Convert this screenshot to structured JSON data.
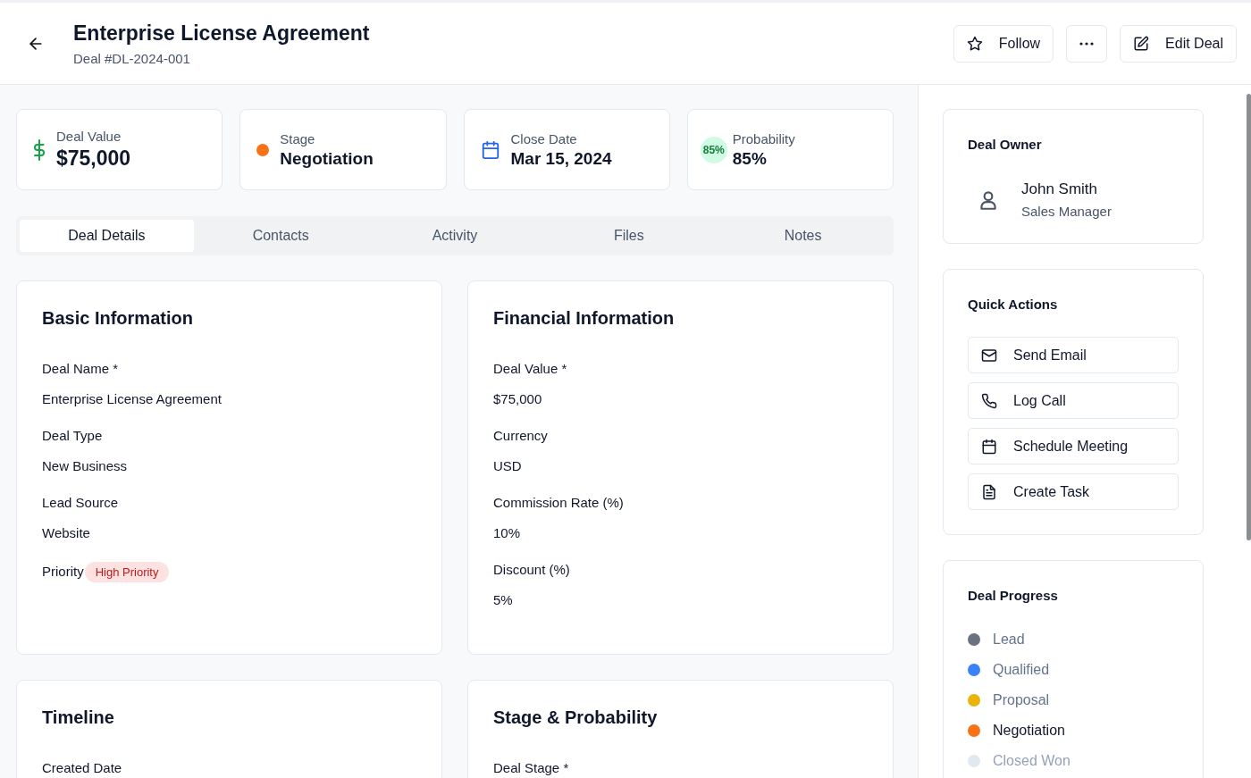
{
  "header": {
    "title": "Enterprise License Agreement",
    "subtitle": "Deal #DL-2024-001"
  },
  "actions": [
    {
      "kind": "follow",
      "label": "Follow"
    },
    {
      "kind": "more"
    },
    {
      "kind": "edit",
      "label": "Edit Deal"
    }
  ],
  "stats": [
    {
      "kind": "money",
      "label": "Deal Value",
      "value": "$75,000"
    },
    {
      "kind": "dot",
      "label": "Stage",
      "value": "Negotiation",
      "color": "#f97316"
    },
    {
      "kind": "calendar",
      "label": "Close Date",
      "value": "Mar 15, 2024"
    },
    {
      "kind": "percent",
      "badge": "85%",
      "label": "Probability",
      "value": "85%"
    }
  ],
  "tabs": [
    {
      "label": "Deal Details",
      "selected": true
    },
    {
      "label": "Contacts",
      "selected": false
    },
    {
      "label": "Activity",
      "selected": false
    },
    {
      "label": "Files",
      "selected": false
    },
    {
      "label": "Notes",
      "selected": false
    }
  ],
  "sections": [
    {
      "title": "Basic Information",
      "fields": [
        {
          "label": "Deal Name *",
          "value": "Enterprise License Agreement"
        },
        {
          "label": "Deal Type",
          "value": "New Business"
        },
        {
          "label": "Lead Source",
          "value": "Website"
        },
        {
          "label": "Priority",
          "badge": "High Priority"
        }
      ]
    },
    {
      "title": "Financial Information",
      "fields": [
        {
          "label": "Deal Value *",
          "value": "$75,000"
        },
        {
          "label": "Currency",
          "value": "USD"
        },
        {
          "label": "Commission Rate (%)",
          "value": "10%"
        },
        {
          "label": "Discount (%)",
          "value": "5%"
        }
      ]
    },
    {
      "title": "Timeline",
      "fields": [
        {
          "label": "Created Date"
        }
      ]
    },
    {
      "title": "Stage & Probability",
      "fields": [
        {
          "label": "Deal Stage *"
        }
      ]
    }
  ],
  "owner": {
    "heading": "Deal Owner",
    "name": "John Smith",
    "role": "Sales Manager"
  },
  "quick_actions": {
    "heading": "Quick Actions",
    "items": [
      {
        "kind": "mail",
        "label": "Send Email"
      },
      {
        "kind": "phone",
        "label": "Log Call"
      },
      {
        "kind": "calendar",
        "label": "Schedule Meeting"
      },
      {
        "kind": "document",
        "label": "Create Task"
      }
    ]
  },
  "progress": {
    "heading": "Deal Progress",
    "stages": [
      {
        "label": "Lead",
        "color": "#6b7280",
        "kind": "done"
      },
      {
        "label": "Qualified",
        "color": "#3b82f6",
        "kind": "done"
      },
      {
        "label": "Proposal",
        "color": "#eab308",
        "kind": "done"
      },
      {
        "label": "Negotiation",
        "color": "#f97316",
        "kind": "current"
      },
      {
        "label": "Closed Won",
        "color": "#e2e8f0",
        "kind": "pending"
      }
    ]
  }
}
